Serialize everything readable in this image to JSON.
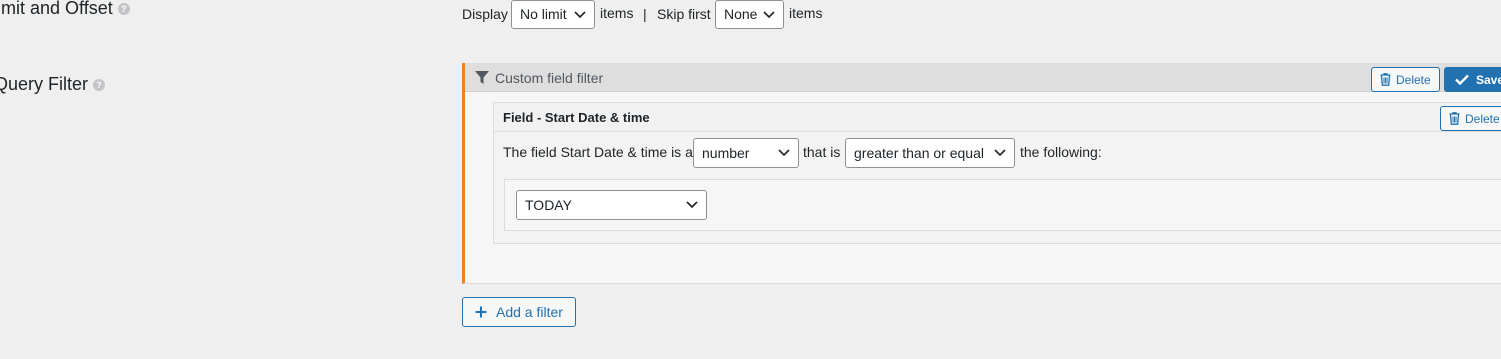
{
  "limit_offset": {
    "label": "imit and Offset",
    "display_text": "Display",
    "limit_value": "No limit",
    "items_text_1": "items",
    "separator": "|",
    "skip_text": "Skip first",
    "skip_value": "None",
    "items_text_2": "items"
  },
  "query_filter": {
    "label": "Query Filter",
    "filter_panel": {
      "title": "Custom field filter",
      "delete_label": "Delete",
      "save_label": "Save",
      "field": {
        "title": "Field - Start Date & time",
        "delete_label": "Delete",
        "sentence_prefix": "The field Start Date & time is a",
        "type_value": "number",
        "that_is_text": "that is",
        "comparison_value": "greater than or equal",
        "following_text": "the following:",
        "value_select": "TODAY"
      }
    },
    "add_filter_label": "Add a filter"
  },
  "colors": {
    "accent_orange": "#f0821e",
    "primary_blue": "#2271b1",
    "background": "#efefef"
  }
}
